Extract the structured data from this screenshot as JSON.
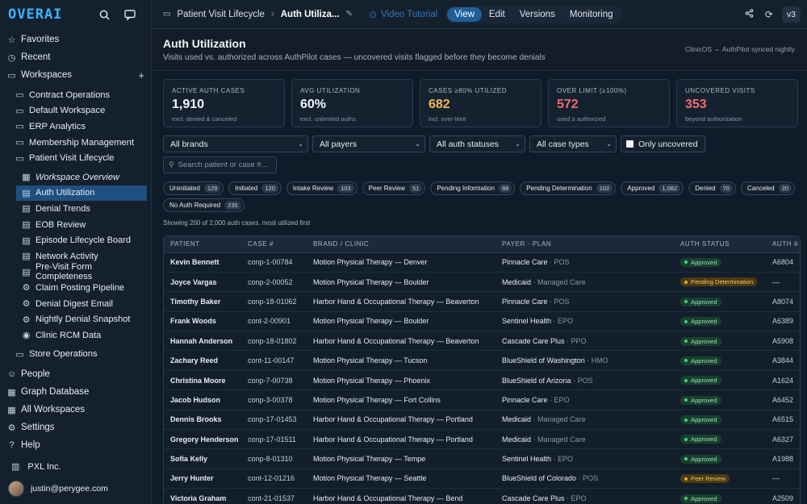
{
  "app": {
    "logo": "OVERAI"
  },
  "sidebar": {
    "top": [
      {
        "label": "Favorites",
        "icon": "star-icon"
      },
      {
        "label": "Recent",
        "icon": "clock-icon"
      },
      {
        "label": "Workspaces",
        "icon": "folder-icon"
      }
    ],
    "workspaces": [
      "Contract Operations",
      "Default Workspace",
      "ERP Analytics",
      "Membership Management",
      "Patient Visit Lifecycle"
    ],
    "pvl_items": [
      "Workspace Overview",
      "Auth Utilization",
      "Denial Trends",
      "EOB Review",
      "Episode Lifecycle Board",
      "Network Activity",
      "Pre-Visit Form Completeness",
      "Claim Posting Pipeline",
      "Denial Digest Email",
      "Nightly Denial Snapshot",
      "Clinic RCM Data"
    ],
    "store_ops": "Store Operations",
    "bottom": [
      "People",
      "Graph Database",
      "All Workspaces",
      "Settings",
      "Help"
    ],
    "org": "PXL Inc.",
    "user_email": "justin@perygee.com"
  },
  "topbar": {
    "crumb_parent": "Patient Visit Lifecycle",
    "crumb_current": "Auth Utiliza...",
    "video_label": "Video Tutorial",
    "tabs": [
      "View",
      "Edit",
      "Versions",
      "Monitoring"
    ],
    "version": "v3"
  },
  "header": {
    "title": "Auth Utilization",
    "subtitle": "Visits used vs. authorized across AuthPilot cases — uncovered visits flagged before they become denials",
    "sync": "ClinicOS ⇔ AuthPilot synced nightly"
  },
  "cards": [
    {
      "label": "ACTIVE AUTH CASES",
      "value": "1,910",
      "note": "excl. denied & canceled"
    },
    {
      "label": "AVG UTILIZATION",
      "value": "60%",
      "note": "excl. unlimited auths"
    },
    {
      "label": "CASES ≥80% UTILIZED",
      "value": "682",
      "note": "incl. over-limit"
    },
    {
      "label": "OVER LIMIT (≥100%)",
      "value": "572",
      "note": "used ≥ authorized"
    },
    {
      "label": "UNCOVERED VISITS",
      "value": "353",
      "note": "beyond authorization"
    }
  ],
  "filters": {
    "brands": "All brands",
    "payers": "All payers",
    "statuses": "All auth statuses",
    "case_types": "All case types",
    "only_uncovered": "Only uncovered",
    "search_placeholder": "Search patient or case #..."
  },
  "chips": [
    {
      "label": "Uninitiated",
      "count": "129"
    },
    {
      "label": "Initiated",
      "count": "120"
    },
    {
      "label": "Intake Review",
      "count": "103"
    },
    {
      "label": "Peer Review",
      "count": "51"
    },
    {
      "label": "Pending Information",
      "count": "88"
    },
    {
      "label": "Pending Determination",
      "count": "102"
    },
    {
      "label": "Approved",
      "count": "1,082"
    },
    {
      "label": "Denied",
      "count": "70"
    },
    {
      "label": "Canceled",
      "count": "20"
    },
    {
      "label": "No Auth Required",
      "count": "235"
    }
  ],
  "showing": "Showing 200 of 2,000 auth cases, most utilized first",
  "table": {
    "headers": [
      "PATIENT",
      "CASE #",
      "BRAND / CLINIC",
      "PAYER · PLAN",
      "AUTH STATUS",
      "AUTH #"
    ],
    "rows": [
      [
        "Kevin Bennett",
        "conp-1-00784",
        "Motion Physical Therapy — Denver",
        "Pinnacle Care",
        "POS",
        "Approved",
        "A6804"
      ],
      [
        "Joyce Vargas",
        "conp-2-00052",
        "Motion Physical Therapy — Boulder",
        "Medicaid",
        "Managed Care",
        "Pending Determination",
        "—"
      ],
      [
        "Timothy Baker",
        "conp-18-01062",
        "Harbor Hand & Occupational Therapy — Beaverton",
        "Pinnacle Care",
        "POS",
        "Approved",
        "A8074"
      ],
      [
        "Frank Woods",
        "cont-2-00901",
        "Motion Physical Therapy — Boulder",
        "Sentinel Health",
        "EPO",
        "Approved",
        "A6389"
      ],
      [
        "Hannah Anderson",
        "conp-18-01802",
        "Harbor Hand & Occupational Therapy — Beaverton",
        "Cascade Care Plus",
        "PPO",
        "Approved",
        "A5908"
      ],
      [
        "Zachary Reed",
        "cont-11-00147",
        "Motion Physical Therapy — Tucson",
        "BlueShield of Washington",
        "HMO",
        "Approved",
        "A3844"
      ],
      [
        "Christina Moore",
        "conp-7-00738",
        "Motion Physical Therapy — Phoenix",
        "BlueShield of Arizona",
        "POS",
        "Approved",
        "A1624"
      ],
      [
        "Jacob Hudson",
        "conp-3-00378",
        "Motion Physical Therapy — Fort Collins",
        "Pinnacle Care",
        "EPO",
        "Approved",
        "A6452"
      ],
      [
        "Dennis Brooks",
        "conp-17-01453",
        "Harbor Hand & Occupational Therapy — Portland",
        "Medicaid",
        "Managed Care",
        "Approved",
        "A6515"
      ],
      [
        "Gregory Henderson",
        "conp-17-01511",
        "Harbor Hand & Occupational Therapy — Portland",
        "Medicaid",
        "Managed Care",
        "Approved",
        "A6327"
      ],
      [
        "Sofia Kelly",
        "conp-8-01310",
        "Motion Physical Therapy — Tempe",
        "Sentinel Health",
        "EPO",
        "Approved",
        "A1988"
      ],
      [
        "Jerry Hunter",
        "cont-12-01216",
        "Motion Physical Therapy — Seattle",
        "BlueShield of Colorado",
        "POS",
        "Peer Review",
        "—"
      ],
      [
        "Victoria Graham",
        "cont-21-01537",
        "Harbor Hand & Occupational Therapy — Bend",
        "Cascade Care Plus",
        "EPO",
        "Approved",
        "A2509"
      ]
    ]
  }
}
